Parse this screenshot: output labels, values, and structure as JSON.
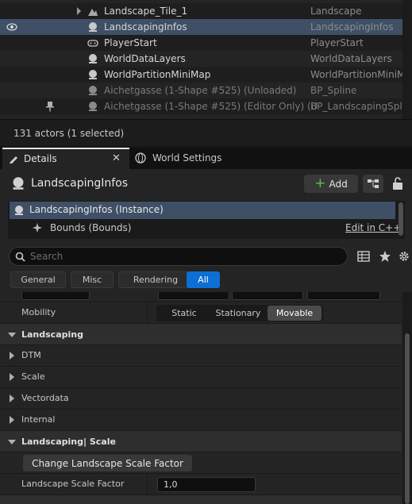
{
  "outliner": {
    "rows": [
      {
        "name": "Landscape_Tile_1",
        "type": "Landscape"
      },
      {
        "name": "LandscapingInfos",
        "type": "LandscapingInfos"
      },
      {
        "name": "PlayerStart",
        "type": "PlayerStart"
      },
      {
        "name": "WorldDataLayers",
        "type": "WorldDataLayers"
      },
      {
        "name": "WorldPartitionMiniMap",
        "type": "WorldPartitionMiniM"
      },
      {
        "name": "Aichetgasse (1-Shape #525) (Unloaded)",
        "type": "BP_Spline"
      },
      {
        "name": "Aichetgasse (1-Shape #525) (Editor Only) (U",
        "type": "BP_LandscapingSpli"
      }
    ],
    "status": "131 actors (1 selected)"
  },
  "tabs": {
    "details": "Details",
    "world_settings": "World Settings"
  },
  "details": {
    "title": "LandscapingInfos",
    "add_label": "Add",
    "instance_label": "LandscapingInfos (Instance)",
    "bounds_label": "Bounds (Bounds)",
    "edit_cpp": "Edit in C++",
    "search_placeholder": "Search",
    "filters": [
      "General",
      "Misc",
      "Rendering",
      "All"
    ],
    "active_filter": "All"
  },
  "properties": {
    "mobility_label": "Mobility",
    "mobility_options": [
      "Static",
      "Stationary",
      "Movable"
    ],
    "mobility_selected": "Movable",
    "cat_landscaping": "Landscaping",
    "sub_dtm": "DTM",
    "sub_scale": "Scale",
    "sub_vectordata": "Vectordata",
    "sub_internal": "Internal",
    "cat_landscaping_scale": "Landscaping| Scale",
    "change_button": "Change Landscape Scale Factor",
    "scale_factor_label": "Landscape Scale Factor",
    "scale_factor_value": "1,0"
  },
  "colors": {
    "selection": "#3e4f66",
    "accent": "#0d6fd6",
    "add_plus": "#5ec14a"
  }
}
